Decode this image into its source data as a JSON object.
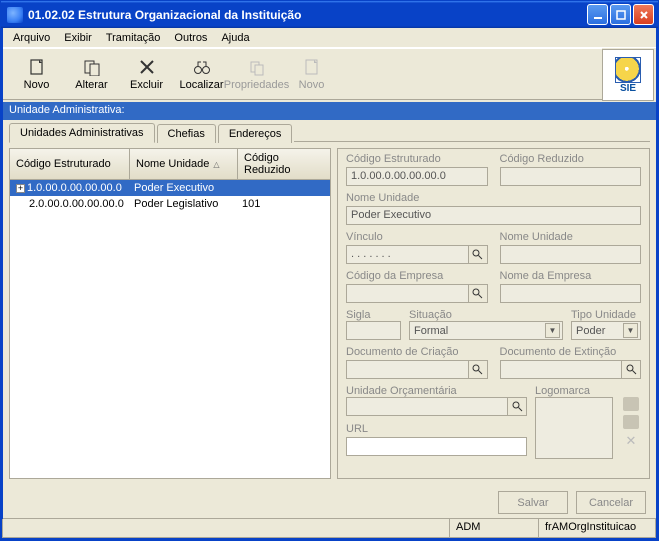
{
  "window": {
    "title": "01.02.02 Estrutura Organizacional da Instituição"
  },
  "menu": {
    "arquivo": "Arquivo",
    "exibir": "Exibir",
    "tramitacao": "Tramitação",
    "outros": "Outros",
    "ajuda": "Ajuda"
  },
  "toolbar": {
    "novo": "Novo",
    "alterar": "Alterar",
    "excluir": "Excluir",
    "localizar": "Localizar",
    "propriedades": "Propriedades",
    "novo2": "Novo"
  },
  "section": {
    "title": "Unidade Administrativa:"
  },
  "tabs": {
    "t1": "Unidades Administrativas",
    "t2": "Chefias",
    "t3": "Endereços"
  },
  "grid": {
    "headers": {
      "codigo_estruturado": "Código Estruturado",
      "nome_unidade": "Nome Unidade",
      "codigo_reduzido": "Código Reduzido"
    },
    "rows": [
      {
        "codigo": "1.0.00.0.00.00.00.0",
        "nome": "Poder Executivo",
        "reduzido": "",
        "expandable": true,
        "selected": true
      },
      {
        "codigo": "2.0.00.0.00.00.00.0",
        "nome": "Poder Legislativo",
        "reduzido": "101",
        "expandable": false,
        "selected": false
      }
    ]
  },
  "form": {
    "labels": {
      "codigo_estruturado": "Código Estruturado",
      "codigo_reduzido": "Código Reduzido",
      "nome_unidade": "Nome Unidade",
      "vinculo": "Vínculo",
      "nome_unidade2": "Nome Unidade",
      "codigo_empresa": "Código da Empresa",
      "nome_empresa": "Nome da Empresa",
      "sigla": "Sigla",
      "situacao": "Situação",
      "tipo_unidade": "Tipo Unidade",
      "doc_criacao": "Documento de Criação",
      "doc_extincao": "Documento de Extinção",
      "unidade_orcamentaria": "Unidade Orçamentária",
      "logomarca": "Logomarca",
      "url": "URL"
    },
    "values": {
      "codigo_estruturado": "1.0.00.0.00.00.00.0",
      "codigo_reduzido": "",
      "nome_unidade": "Poder Executivo",
      "vinculo": ". . . . . . .",
      "nome_unidade2": "",
      "codigo_empresa": "",
      "nome_empresa": "",
      "sigla": "",
      "situacao": "Formal",
      "tipo_unidade": "Poder",
      "doc_criacao": "",
      "doc_extincao": "",
      "unidade_orcamentaria": "",
      "url": ""
    }
  },
  "buttons": {
    "salvar": "Salvar",
    "cancelar": "Cancelar"
  },
  "status": {
    "user": "ADM",
    "form": "frAMOrgInstituicao"
  },
  "logo_text": "SIE"
}
